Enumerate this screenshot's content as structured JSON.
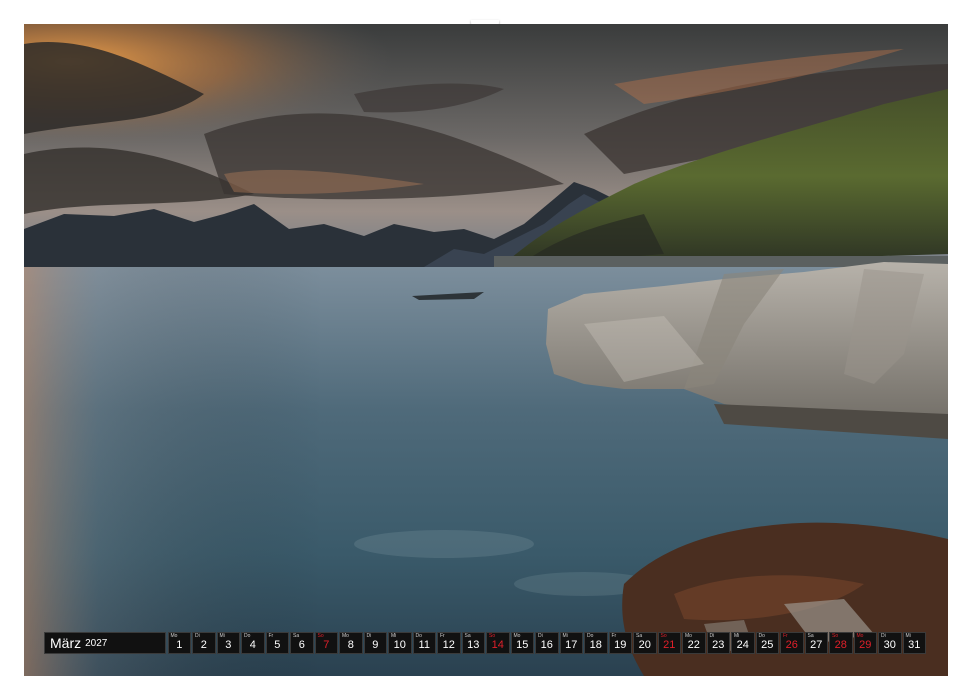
{
  "calendar": {
    "month": "März",
    "year": "2027",
    "days": [
      {
        "wd": "Mo",
        "n": "1",
        "red": false
      },
      {
        "wd": "Di",
        "n": "2",
        "red": false
      },
      {
        "wd": "Mi",
        "n": "3",
        "red": false
      },
      {
        "wd": "Do",
        "n": "4",
        "red": false
      },
      {
        "wd": "Fr",
        "n": "5",
        "red": false
      },
      {
        "wd": "Sa",
        "n": "6",
        "red": false
      },
      {
        "wd": "So",
        "n": "7",
        "red": true
      },
      {
        "wd": "Mo",
        "n": "8",
        "red": false
      },
      {
        "wd": "Di",
        "n": "9",
        "red": false
      },
      {
        "wd": "Mi",
        "n": "10",
        "red": false
      },
      {
        "wd": "Do",
        "n": "11",
        "red": false
      },
      {
        "wd": "Fr",
        "n": "12",
        "red": false
      },
      {
        "wd": "Sa",
        "n": "13",
        "red": false
      },
      {
        "wd": "So",
        "n": "14",
        "red": true
      },
      {
        "wd": "Mo",
        "n": "15",
        "red": false
      },
      {
        "wd": "Di",
        "n": "16",
        "red": false
      },
      {
        "wd": "Mi",
        "n": "17",
        "red": false
      },
      {
        "wd": "Do",
        "n": "18",
        "red": false
      },
      {
        "wd": "Fr",
        "n": "19",
        "red": false
      },
      {
        "wd": "Sa",
        "n": "20",
        "red": false
      },
      {
        "wd": "So",
        "n": "21",
        "red": true
      },
      {
        "wd": "Mo",
        "n": "22",
        "red": false
      },
      {
        "wd": "Di",
        "n": "23",
        "red": false
      },
      {
        "wd": "Mi",
        "n": "24",
        "red": false
      },
      {
        "wd": "Do",
        "n": "25",
        "red": false
      },
      {
        "wd": "Fr",
        "n": "26",
        "red": true
      },
      {
        "wd": "Sa",
        "n": "27",
        "red": false
      },
      {
        "wd": "So",
        "n": "28",
        "red": true
      },
      {
        "wd": "Mo",
        "n": "29",
        "red": true
      },
      {
        "wd": "Di",
        "n": "30",
        "red": false
      },
      {
        "wd": "Mi",
        "n": "31",
        "red": false
      }
    ]
  },
  "colors": {
    "holiday": "#e0202a",
    "strip_bg": "#111111",
    "text": "#ffffff"
  }
}
